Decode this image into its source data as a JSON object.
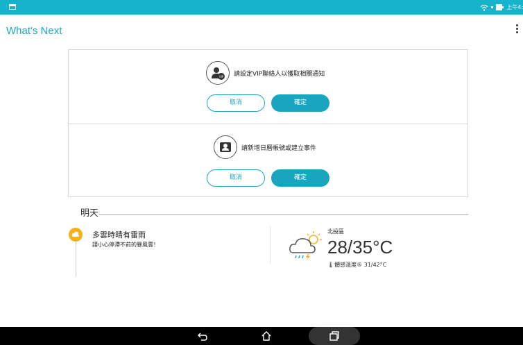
{
  "status_bar": {
    "time": "上午4:",
    "icons": [
      "notification-icon",
      "wifi-icon",
      "battery-icon"
    ]
  },
  "app_bar": {
    "title": "What's Next",
    "menu_icon": "overflow-menu-icon"
  },
  "cards": [
    {
      "icon": "vip-contact-icon",
      "message": "請設定VIP聯絡人以獲取相關通知",
      "cancel_label": "取消",
      "confirm_label": "確定"
    },
    {
      "icon": "calendar-account-icon",
      "message": "請新增日曆帳號或建立事件",
      "cancel_label": "取消",
      "confirm_label": "確定"
    }
  ],
  "tomorrow": {
    "heading": "明天",
    "forecast_title": "多雲時晴有雷雨",
    "forecast_desc": "請小心停滯不前的暴風雲！",
    "location": "北投區",
    "temperature": "28/35°C",
    "feels_like": "體感溫度® 31/42°C"
  },
  "colors": {
    "accent": "#1aa5bf",
    "status_bar": "#17b3cc",
    "weather_badge": "#f5b21b",
    "nav_bar": "#000000"
  },
  "nav_bar": {
    "buttons": [
      "back-icon",
      "home-icon",
      "recent-apps-icon"
    ]
  }
}
